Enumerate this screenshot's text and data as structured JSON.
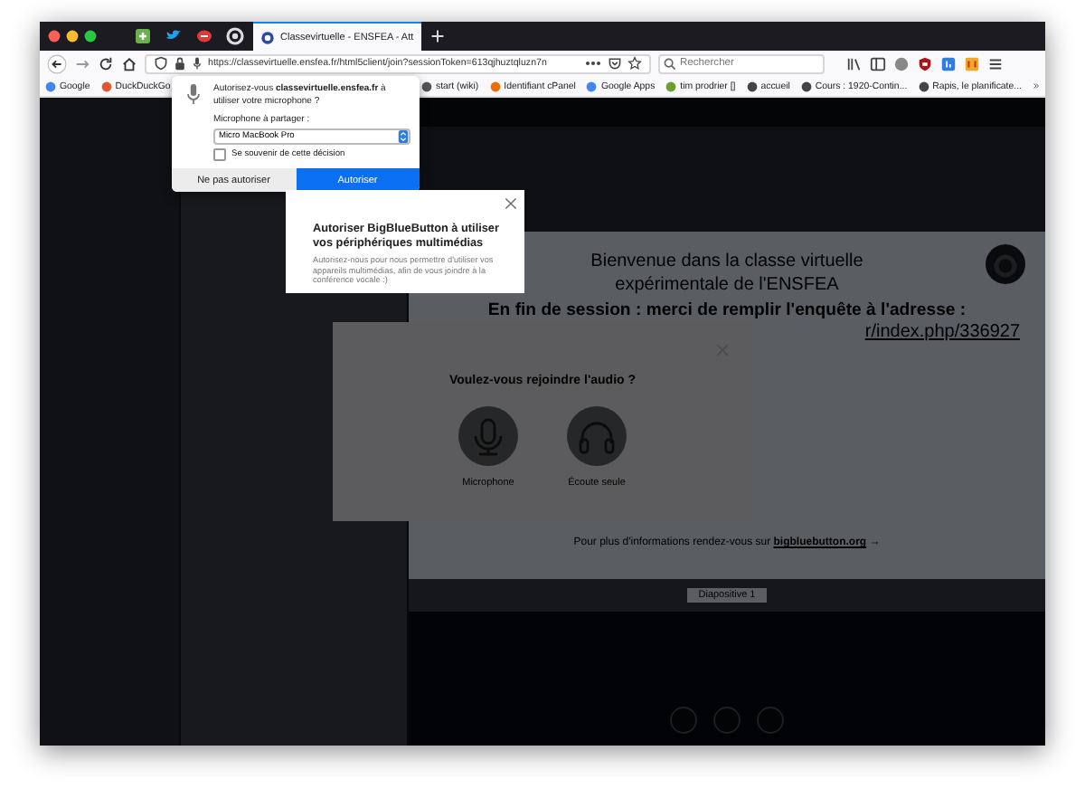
{
  "browser": {
    "tab_title": "Classevirtuelle - ENSFEA - Att",
    "url": "https://classevirtuelle.ensfea.fr/html5client/join?sessionToken=613qjhuztqluzn7n",
    "search": {
      "placeholder": "Rechercher"
    },
    "bookmarks_left": [
      "Google",
      "DuckDuckGo"
    ],
    "bookmarks_right": [
      "start (wiki)",
      "Identifiant cPanel",
      "Google Apps",
      "tim prodrier []",
      "accueil",
      "Cours : 1920-Contin...",
      "Rapis, le planificate..."
    ]
  },
  "permission_prompt": {
    "message": "Autorisez-vous **classevirtuelle.ensfea.fr** à utiliser votre microphone ?",
    "select_label": "Microphone à partager :",
    "device": "Micro MacBook Pro",
    "remember": {
      "label": "Se souvenir de cette décision",
      "checked": false
    },
    "buttons": [
      {
        "label": "Ne pas autoriser",
        "kind": "secondary"
      },
      {
        "label": "Autoriser",
        "kind": "primary"
      }
    ]
  },
  "bbb_notice": {
    "title": "Autoriser BigBlueButton à utiliser vos périphériques multimédias",
    "text": "Autorisez-nous pour nous permettre d'utiliser vos appareils multimédias, afin de vous joindre à la conférence vocale :)"
  },
  "slide": {
    "lines": [
      "Bienvenue dans la classe virtuelle",
      "expérimentale de l'ENSFEA",
      "En fin de session : merci de remplir l'enquête à l'adresse :"
    ],
    "link": "r/index.php/336927",
    "footer": "Pour plus d'informations rendez-vous sur **bigbluebutton.org** →",
    "selector": "Diapositive 1"
  },
  "audio_modal": {
    "title": "Voulez-vous rejoindre l'audio ?",
    "options": [
      {
        "kind": "microphone",
        "label": "Microphone"
      },
      {
        "kind": "listen",
        "label": "Écoute seule"
      }
    ]
  }
}
